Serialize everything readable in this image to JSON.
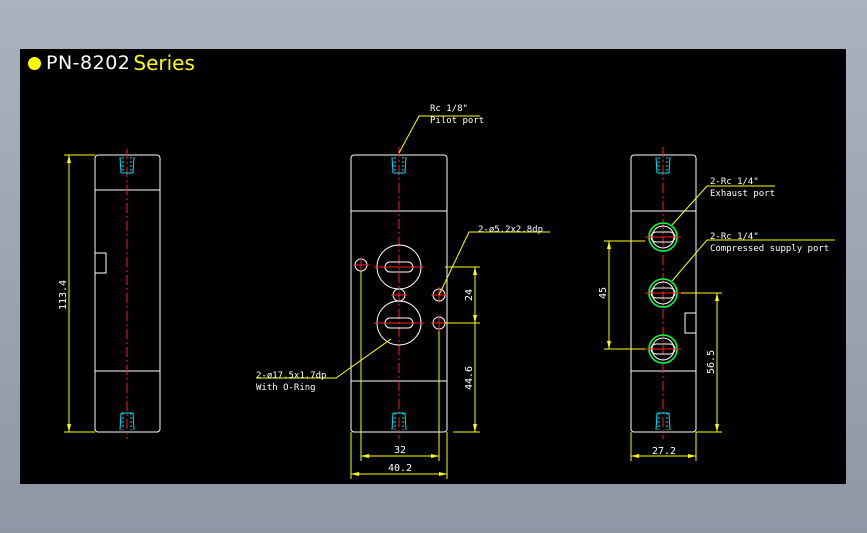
{
  "title": {
    "model": "PN-8202",
    "series": "Series"
  },
  "callouts": {
    "pilot_port_size": "Rc 1/8\"",
    "pilot_port_name": "Pilot port",
    "mount_hole": "2-ø5.2x2.8dp",
    "oring_pocket": "2-ø17.5x1.7dp",
    "oring_note": "With O-Ring",
    "exhaust_size": "2-Rc 1/4\"",
    "exhaust_name": "Exhaust port",
    "supply_size": "2-Rc 1/4\"",
    "supply_name": "Compressed supply port"
  },
  "dimensions": {
    "overall_height": "113.4",
    "front_spacing": "24",
    "front_offset": "44.6",
    "front_width_inner": "32",
    "front_width": "40.2",
    "side_spacing": "45",
    "side_offset": "56.5",
    "side_width": "27.2"
  },
  "colors": {
    "background": "#000000",
    "outline": "#ffffff",
    "dimension": "#ffff00",
    "centerline": "#ff2020",
    "thread": "#00e5ff",
    "port": "#00ff40"
  }
}
